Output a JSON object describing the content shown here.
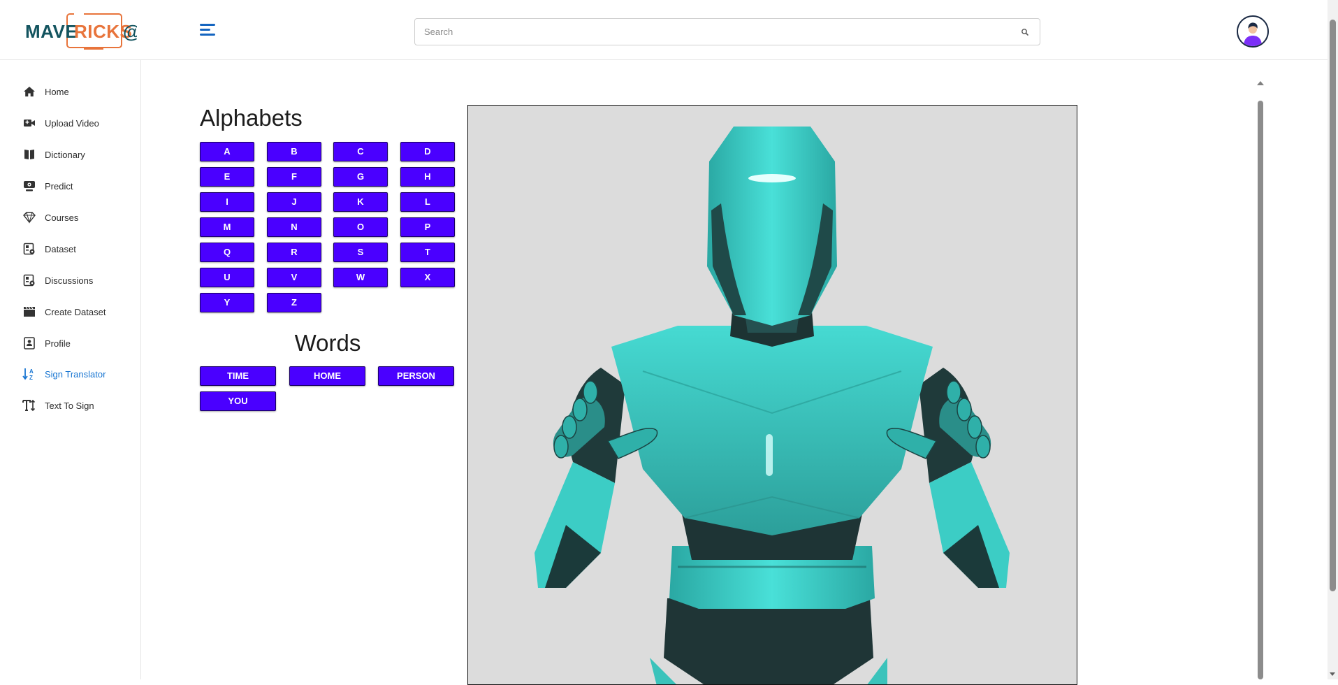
{
  "app": {
    "logo_text": "MAVERICKS@"
  },
  "search": {
    "placeholder": "Search"
  },
  "sidebar": {
    "items": [
      {
        "label": "Home",
        "icon": "home-icon"
      },
      {
        "label": "Upload Video",
        "icon": "video-camera-icon"
      },
      {
        "label": "Dictionary",
        "icon": "book-icon"
      },
      {
        "label": "Predict",
        "icon": "webcam-icon"
      },
      {
        "label": "Courses",
        "icon": "gem-icon"
      },
      {
        "label": "Dataset",
        "icon": "dataset-icon"
      },
      {
        "label": "Discussions",
        "icon": "discussion-icon"
      },
      {
        "label": "Create Dataset",
        "icon": "clapperboard-icon"
      },
      {
        "label": "Profile",
        "icon": "profile-card-icon"
      },
      {
        "label": "Sign Translator",
        "icon": "sort-alpha-icon",
        "active": true
      },
      {
        "label": "Text To Sign",
        "icon": "text-height-icon"
      }
    ]
  },
  "main": {
    "alphabets_title": "Alphabets",
    "letters": [
      "A",
      "B",
      "C",
      "D",
      "E",
      "F",
      "G",
      "H",
      "I",
      "J",
      "K",
      "L",
      "M",
      "N",
      "O",
      "P",
      "Q",
      "R",
      "S",
      "T",
      "U",
      "V",
      "W",
      "X",
      "Y",
      "Z"
    ],
    "words_title": "Words",
    "words": [
      "TIME",
      "HOME",
      "PERSON",
      "YOU"
    ]
  },
  "colors": {
    "button_bg": "#4a00ff",
    "active_nav": "#1976d2",
    "avatar_body": "#7b2ff7",
    "robot_teal": "#3fd3cc",
    "robot_dark": "#1f3a3a"
  }
}
